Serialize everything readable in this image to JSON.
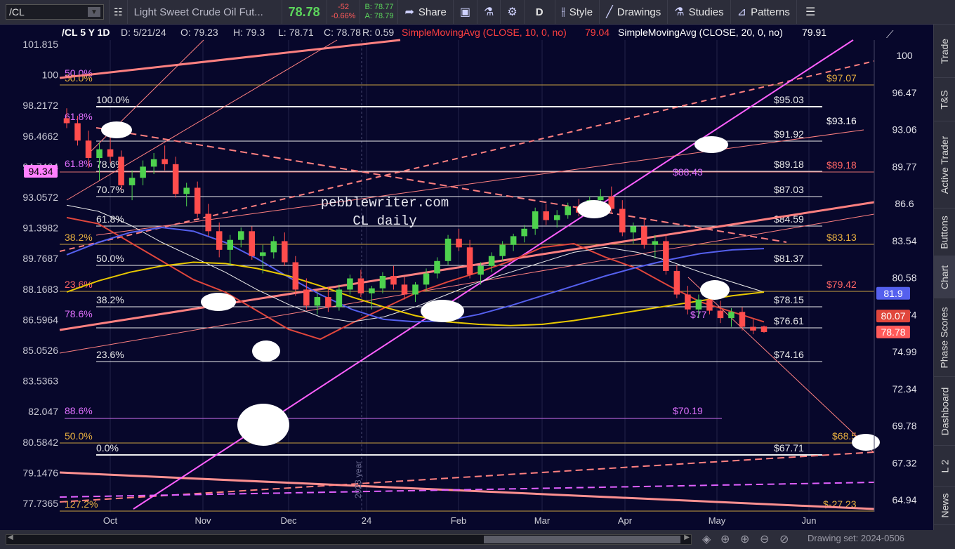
{
  "toolbar": {
    "symbol": "/CL",
    "description": "Light Sweet Crude Oil Fut...",
    "last": "78.78",
    "change": "-52",
    "change_pct": "-0.66%",
    "bid": "B: 78.77",
    "ask": "A: 78.79",
    "share": "Share",
    "period": "D",
    "style": "Style",
    "drawings": "Drawings",
    "studies": "Studies",
    "patterns": "Patterns",
    "colors": {
      "up": "#5cd65c",
      "down": "#ff5a5a",
      "bg": "#2c2d3a"
    }
  },
  "header": {
    "symbol": "/CL 5 Y 1D",
    "date": "D: 5/21/24",
    "open": "O: 79.23",
    "high": "H: 79.3",
    "low": "L: 78.71",
    "close": "C: 78.78",
    "range": "R: 0.59",
    "sma10_label": "SimpleMovingAvg (CLOSE, 10, 0, no)",
    "sma10_value": "79.04",
    "sma20_label": "SimpleMovingAvg (CLOSE, 20, 0, no)",
    "sma20_value": "79.91"
  },
  "watermark": [
    "pebblewriter.com",
    "CL daily"
  ],
  "year_marker": "2023 year",
  "sidebar": [
    "Trade",
    "T&S",
    "Active Trader",
    "Buttons",
    "Chart",
    "Phase Scores",
    "Dashboard",
    "L 2",
    "News"
  ],
  "bottom": {
    "drawing_set": "Drawing set: 2024-0506"
  },
  "chart_data": {
    "type": "candlestick",
    "x_ticks": [
      "Oct",
      "Nov",
      "Dec",
      "24",
      "Feb",
      "Mar",
      "Apr",
      "May",
      "Jun"
    ],
    "right_axis": [
      "100",
      "96.47",
      "93.06",
      "89.77",
      "86.6",
      "83.54",
      "80.58",
      "77.74",
      "74.99",
      "72.34",
      "69.78",
      "67.32",
      "64.94"
    ],
    "left_axis": [
      "101.815",
      "100",
      "98.2172",
      "96.4662",
      "94.7464",
      "93.0572",
      "91.3982",
      "89.7687",
      "88.1683",
      "86.5964",
      "85.0526",
      "83.5363",
      "82.047",
      "80.5842",
      "79.1476",
      "77.7365"
    ],
    "ylim": [
      64.3,
      102.3
    ],
    "price_badges": [
      {
        "text": "81.9",
        "value": 81.9,
        "color": "#5560ee"
      },
      {
        "text": "80.07",
        "value": 80.07,
        "color": "#e0463c"
      },
      {
        "text": "78.78",
        "value": 78.78,
        "color": "#ff5a5a"
      }
    ],
    "left_badge": {
      "text": "94.34",
      "color": "#ff7fff"
    },
    "fib_levels": [
      {
        "pct": "100.0%",
        "price": "$95.03"
      },
      {
        "pct": "",
        "price": "$91.92"
      },
      {
        "pct": "78.6%",
        "price": "$89.18"
      },
      {
        "pct": "70.7%",
        "price": "$87.03"
      },
      {
        "pct": "61.8%",
        "price": "$84.59"
      },
      {
        "pct": "50.0%",
        "price": "$81.37"
      },
      {
        "pct": "38.2%",
        "price": "$78.15"
      },
      {
        "pct": "",
        "price": "$76.61"
      },
      {
        "pct": "23.6%",
        "price": "$74.16"
      },
      {
        "pct": "0.0%",
        "price": "$67.71"
      }
    ],
    "orange_levels": [
      {
        "pct": "50.0%",
        "price": "$97.07"
      },
      {
        "pct": "",
        "price": "$93.16"
      },
      {
        "pct": "",
        "price": "$89.18"
      },
      {
        "pct": "38.2%",
        "price": "$83.13"
      },
      {
        "pct": "23.6%",
        "price": "$79.42"
      },
      {
        "pct": "50.0%",
        "price": "$68.5"
      },
      {
        "pct": "127.2%",
        "price": "$-27.23"
      }
    ],
    "violet_labels": [
      "$88.43",
      "$77",
      "$70.19",
      "88.6%",
      "78.6%",
      "61.8%",
      "50.0%",
      "61.8%"
    ],
    "series": [
      {
        "name": "SimpleMovingAvg (CLOSE, 10, 0, no)",
        "color": "#e0463c",
        "values": [
          88,
          87.5,
          86,
          84.5,
          83,
          82,
          80.5,
          79,
          78.2,
          79.5,
          80.7,
          81.9,
          82.8,
          83.6,
          84.5,
          85.6,
          85.9,
          84.8,
          83.9,
          82.5,
          81.2,
          80.4,
          79.6
        ]
      },
      {
        "name": "SimpleMovingAvg (CLOSE, 20, 0, no)",
        "color": "#eeeeee",
        "values": [
          89,
          88.5,
          87.4,
          86,
          84.8,
          83.6,
          82.2,
          81,
          80,
          79.6,
          80,
          80.8,
          81.8,
          82.8,
          83.6,
          84.4,
          85.2,
          85.6,
          85.2,
          84.5,
          83.6,
          82.8,
          82
        ]
      },
      {
        "name": "",
        "color": "#5560ee",
        "values": [
          85,
          86,
          86.8,
          87.2,
          86.9,
          86,
          84.7,
          83.2,
          81.8,
          80.6,
          79.8,
          79.6,
          79.7,
          80.2,
          80.9,
          81.7,
          82.5,
          83.3,
          84.0,
          84.6,
          85.1,
          85.4,
          85.5
        ]
      },
      {
        "name": "",
        "color": "#e8c800",
        "values": [
          82,
          82.9,
          83.6,
          84.1,
          84.4,
          84.3,
          83.9,
          83.3,
          82.5,
          81.6,
          80.8,
          80.1,
          79.6,
          79.4,
          79.3,
          79.4,
          79.7,
          80.1,
          80.5,
          80.9,
          81.3,
          81.7,
          82
        ]
      }
    ],
    "candles": [
      [
        96,
        96.8,
        95.2,
        95.6
      ],
      [
        95.6,
        96.2,
        93.8,
        94.2
      ],
      [
        94.2,
        95,
        92,
        92.8
      ],
      [
        92.8,
        94,
        91,
        93.5
      ],
      [
        93.5,
        94.5,
        92.4,
        92.9
      ],
      [
        92.9,
        93.4,
        90.2,
        90.6
      ],
      [
        90.6,
        91.8,
        89.4,
        91.2
      ],
      [
        91.2,
        92.6,
        90.6,
        92.1
      ],
      [
        92.1,
        93.2,
        91.5,
        92.7
      ],
      [
        92.7,
        93.8,
        91.8,
        92.3
      ],
      [
        92.3,
        92.9,
        89.6,
        89.9
      ],
      [
        89.9,
        90.8,
        88.9,
        90.4
      ],
      [
        90.4,
        90.9,
        88,
        88.3
      ],
      [
        88.3,
        89.1,
        86.5,
        86.9
      ],
      [
        86.9,
        87.6,
        84.8,
        85.4
      ],
      [
        85.4,
        86.6,
        84.1,
        86.2
      ],
      [
        86.2,
        87.2,
        85.6,
        86.9
      ],
      [
        86.9,
        87.3,
        84.6,
        84.9
      ],
      [
        84.9,
        85.8,
        83.5,
        85.2
      ],
      [
        85.2,
        86.5,
        84.7,
        86.1
      ],
      [
        86.1,
        86.8,
        84.1,
        84.4
      ],
      [
        84.4,
        84.9,
        81.7,
        82.2
      ],
      [
        82.2,
        83.1,
        80.6,
        80.9
      ],
      [
        80.9,
        81.9,
        80.2,
        81.6
      ],
      [
        81.6,
        82.4,
        80.4,
        80.8
      ],
      [
        80.8,
        82.6,
        80.5,
        82.2
      ],
      [
        82.2,
        83.4,
        81.8,
        83.1
      ],
      [
        83.1,
        83.8,
        81.6,
        81.9
      ],
      [
        81.9,
        82.5,
        80.6,
        82.3
      ],
      [
        82.3,
        83.6,
        81.9,
        83.3
      ],
      [
        83.3,
        84.1,
        82.2,
        82.6
      ],
      [
        82.6,
        83.2,
        81.4,
        81.8
      ],
      [
        81.8,
        82.8,
        81.2,
        82.6
      ],
      [
        82.6,
        83.9,
        82.1,
        83.5
      ],
      [
        83.5,
        84.8,
        83.1,
        84.5
      ],
      [
        84.5,
        86.6,
        84.2,
        86.3
      ],
      [
        86.3,
        87.1,
        85.3,
        85.6
      ],
      [
        85.6,
        86.2,
        83.1,
        83.4
      ],
      [
        83.4,
        84.4,
        82.6,
        84.1
      ],
      [
        84.1,
        85.2,
        83.6,
        84.9
      ],
      [
        84.9,
        86.1,
        84.5,
        85.8
      ],
      [
        85.8,
        86.7,
        85.3,
        86.5
      ],
      [
        86.5,
        87.4,
        86,
        87.1
      ],
      [
        87.1,
        88.8,
        86.6,
        88.5
      ],
      [
        88.5,
        89.1,
        87.4,
        87.8
      ],
      [
        87.8,
        88.6,
        87.2,
        88.2
      ],
      [
        88.2,
        89.2,
        87.9,
        88.9
      ],
      [
        88.9,
        89.5,
        88.1,
        88.4
      ],
      [
        88.4,
        89.7,
        88.1,
        89.4
      ],
      [
        89.4,
        90.3,
        88.8,
        89.7
      ],
      [
        89.7,
        90.5,
        88.4,
        88.7
      ],
      [
        88.7,
        89.4,
        86.5,
        86.8
      ],
      [
        86.8,
        87.6,
        85.9,
        87.3
      ],
      [
        87.3,
        87.9,
        85.5,
        85.8
      ],
      [
        85.8,
        86.6,
        84.7,
        86.1
      ],
      [
        86.1,
        86.7,
        83.4,
        83.7
      ],
      [
        83.7,
        84.2,
        81.5,
        81.8
      ],
      [
        81.8,
        82.5,
        80.2,
        80.6
      ],
      [
        80.6,
        81.8,
        79.9,
        81.4
      ],
      [
        81.4,
        82.1,
        80.2,
        80.5
      ],
      [
        80.5,
        81.3,
        79.5,
        79.9
      ],
      [
        79.9,
        80.7,
        79.2,
        80.4
      ],
      [
        80.4,
        80.8,
        78.9,
        79.2
      ],
      [
        79.2,
        79.8,
        78.6,
        78.9
      ],
      [
        79.23,
        79.3,
        78.71,
        78.78
      ]
    ]
  }
}
